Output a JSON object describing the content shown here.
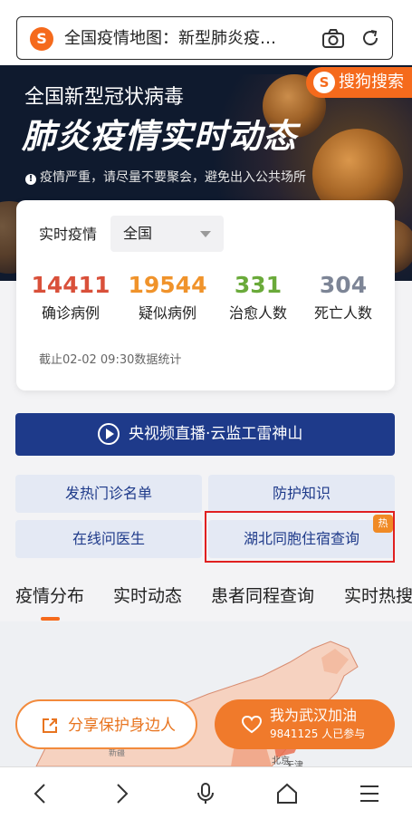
{
  "browser": {
    "url_title": "全国疫情地图：新型肺炎疫…"
  },
  "banner": {
    "brand": "搜狗搜索",
    "subtitle": "全国新型冠状病毒",
    "title": "肺炎疫情实时动态",
    "notice": "疫情严重，请尽量不要聚会，避免出入公共场所"
  },
  "stats": {
    "label": "实时疫情",
    "region": "全国",
    "items": [
      {
        "value": "14411",
        "label": "确诊病例",
        "color": "#d9503a"
      },
      {
        "value": "19544",
        "label": "疑似病例",
        "color": "#f0932b"
      },
      {
        "value": "331",
        "label": "治愈人数",
        "color": "#6aaa3a"
      },
      {
        "value": "304",
        "label": "死亡人数",
        "color": "#7d8596"
      }
    ],
    "as_of": "截止02-02 09:30数据统计"
  },
  "live": {
    "label": "央视频直播·云监工雷神山"
  },
  "quick": {
    "fever_clinics": "发热门诊名单",
    "protection": "防护知识",
    "online_doctor": "在线问医生",
    "hubei_lodging": "湖北同胞住宿查询",
    "hot_badge": "热"
  },
  "tabs": [
    "疫情分布",
    "实时动态",
    "患者同程查询",
    "实时热搜"
  ],
  "map": {
    "label_beijing": "北京",
    "label_other": "天津"
  },
  "actions": {
    "share": "分享保护身边人",
    "cheer": "我为武汉加油",
    "cheer_count": "9841125 人已参与"
  },
  "colors": {
    "brand_orange": "#f56a1c",
    "navy": "#1e3a8a"
  }
}
